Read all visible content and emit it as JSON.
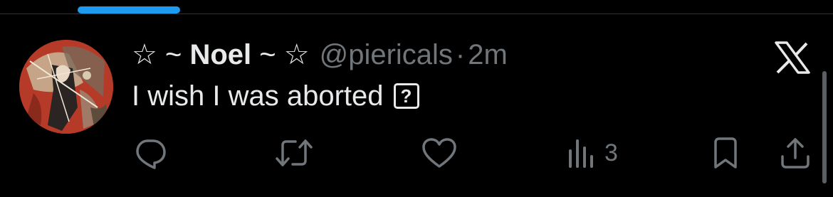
{
  "tab": {
    "active_indicator_color": "#1d9bf0"
  },
  "tweet": {
    "display_name_prefix": "☆ ~ ",
    "display_name_core": "Noel",
    "display_name_suffix": " ~ ☆",
    "handle": "@piericals",
    "separator": "·",
    "timestamp": "2m",
    "text": "I wish I was aborted",
    "missing_glyph": "?",
    "avatar_icon": "avatar-artwork",
    "platform_icon": "x-logo-icon"
  },
  "actions": {
    "reply_icon": "reply-icon",
    "retweet_icon": "retweet-icon",
    "like_icon": "heart-icon",
    "views_icon": "views-chart-icon",
    "views_count": "3",
    "bookmark_icon": "bookmark-icon",
    "share_icon": "share-icon"
  },
  "colors": {
    "background": "#000000",
    "primary_text": "#e7e9ea",
    "secondary_text": "#71767b",
    "divider": "#2f3336"
  }
}
